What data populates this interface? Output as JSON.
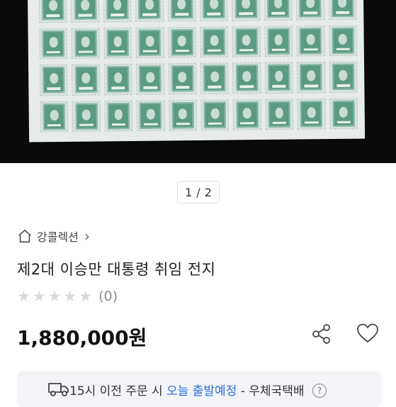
{
  "pager": {
    "current": "1",
    "separator": "/",
    "total": "2"
  },
  "shop": {
    "name": "강콜렉션",
    "chevron": "›",
    "icon": "home-icon"
  },
  "product": {
    "title": "제2대 이승만 대통령 취임 전지",
    "rating_stars_filled": 0,
    "rating_stars_total": 5,
    "review_count": "(0)",
    "price": "1,880,000원"
  },
  "actions": {
    "share_icon": "share-icon",
    "like_icon": "heart-icon"
  },
  "shipping": {
    "prefix": "15시 이전 주문 시",
    "highlight": "오늘 출발예정",
    "suffix": "- 우체국택배",
    "help": "?",
    "highlight_color": "#2a6dd8"
  },
  "colors": {
    "photo_bg": "#0b0b0c",
    "stamp_green": "#5c9b83",
    "star_empty": "#d9d9d9"
  }
}
